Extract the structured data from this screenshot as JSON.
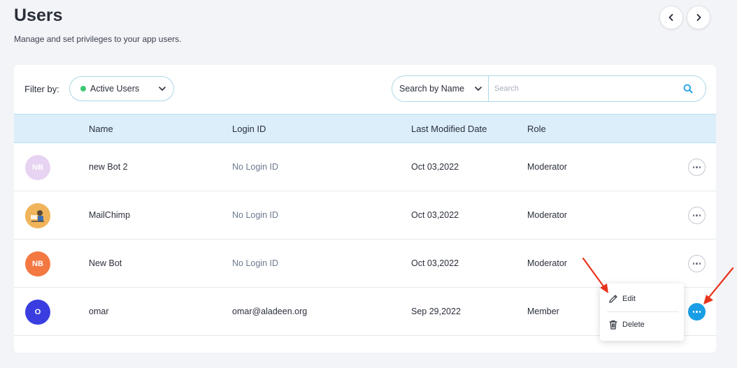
{
  "page": {
    "title": "Users",
    "subtitle": "Manage and set privileges to your app users."
  },
  "nav": {
    "prev_icon": "chevron-left-icon",
    "next_icon": "chevron-right-icon"
  },
  "filter": {
    "label": "Filter by:",
    "selected": "Active Users",
    "status_color": "#3cc771"
  },
  "search": {
    "type_selected": "Search by Name",
    "placeholder": "Search",
    "value": ""
  },
  "table": {
    "columns": [
      "Name",
      "Login ID",
      "Last Modified Date",
      "Role"
    ],
    "rows": [
      {
        "avatar_text": "NB",
        "avatar_color": "#e7d3f2",
        "name": "new Bot 2",
        "login_id": "No Login ID",
        "modified": "Oct 03,2022",
        "role": "Moderator"
      },
      {
        "avatar_text": "",
        "avatar_color": "#f0b45a",
        "name": "MailChimp",
        "login_id": "No Login ID",
        "modified": "Oct 03,2022",
        "role": "Moderator"
      },
      {
        "avatar_text": "NB",
        "avatar_color": "#f47842",
        "name": "New Bot",
        "login_id": "No Login ID",
        "modified": "Oct 03,2022",
        "role": "Moderator"
      },
      {
        "avatar_text": "O",
        "avatar_color": "#3a3ee0",
        "name": "omar",
        "login_id": "omar@aladeen.org",
        "modified": "Sep 29,2022",
        "role": "Member"
      }
    ]
  },
  "context_menu": {
    "edit": "Edit",
    "delete": "Delete"
  },
  "colors": {
    "accent": "#199ee6",
    "header_bg": "#dbeefa",
    "annotation_arrow": "#e8331c"
  }
}
